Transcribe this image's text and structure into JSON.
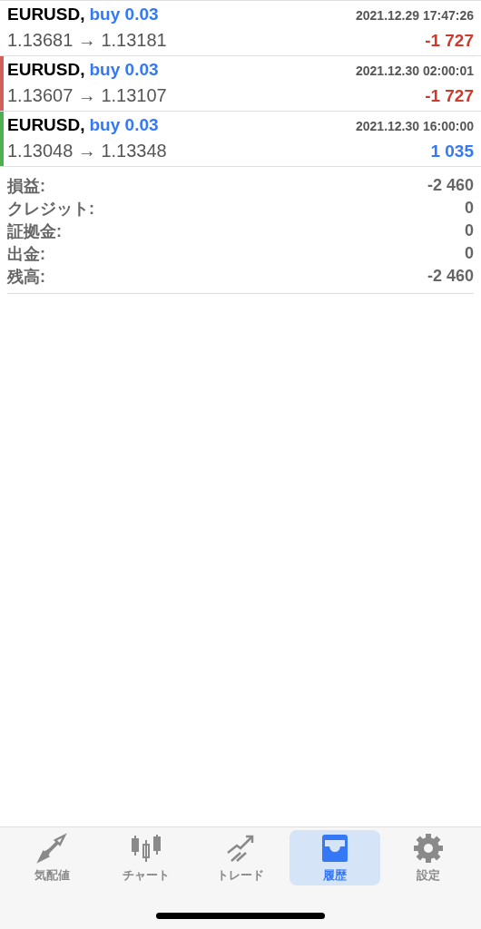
{
  "deals": [
    {
      "symbol": "EURUSD,",
      "order": "buy 0.03",
      "time": "2021.12.29 17:47:26",
      "prices": "1.13681 → 1.13181",
      "profit": "-1 727",
      "kind": "loss"
    },
    {
      "symbol": "EURUSD,",
      "order": "buy 0.03",
      "time": "2021.12.30 02:00:01",
      "prices": "1.13607 → 1.13107",
      "profit": "-1 727",
      "kind": "loss",
      "color": "#d0605a"
    },
    {
      "symbol": "EURUSD,",
      "order": "buy 0.03",
      "time": "2021.12.30 16:00:00",
      "prices": "1.13048 → 1.13348",
      "profit": "1 035",
      "kind": "gain",
      "color": "#4caf50"
    }
  ],
  "summary": [
    {
      "label": "損益:",
      "value": "-2 460"
    },
    {
      "label": "クレジット:",
      "value": "0"
    },
    {
      "label": "証拠金:",
      "value": "0"
    },
    {
      "label": "出金:",
      "value": "0"
    },
    {
      "label": "残高:",
      "value": "-2 460"
    }
  ],
  "tabs": [
    {
      "label": "気配値",
      "kind": "arrows",
      "selected": false
    },
    {
      "label": "チャート",
      "kind": "candles",
      "selected": false
    },
    {
      "label": "トレード",
      "kind": "trend",
      "selected": false
    },
    {
      "label": "履歴",
      "kind": "tray",
      "selected": true
    },
    {
      "label": "設定",
      "kind": "gear",
      "selected": false
    }
  ]
}
